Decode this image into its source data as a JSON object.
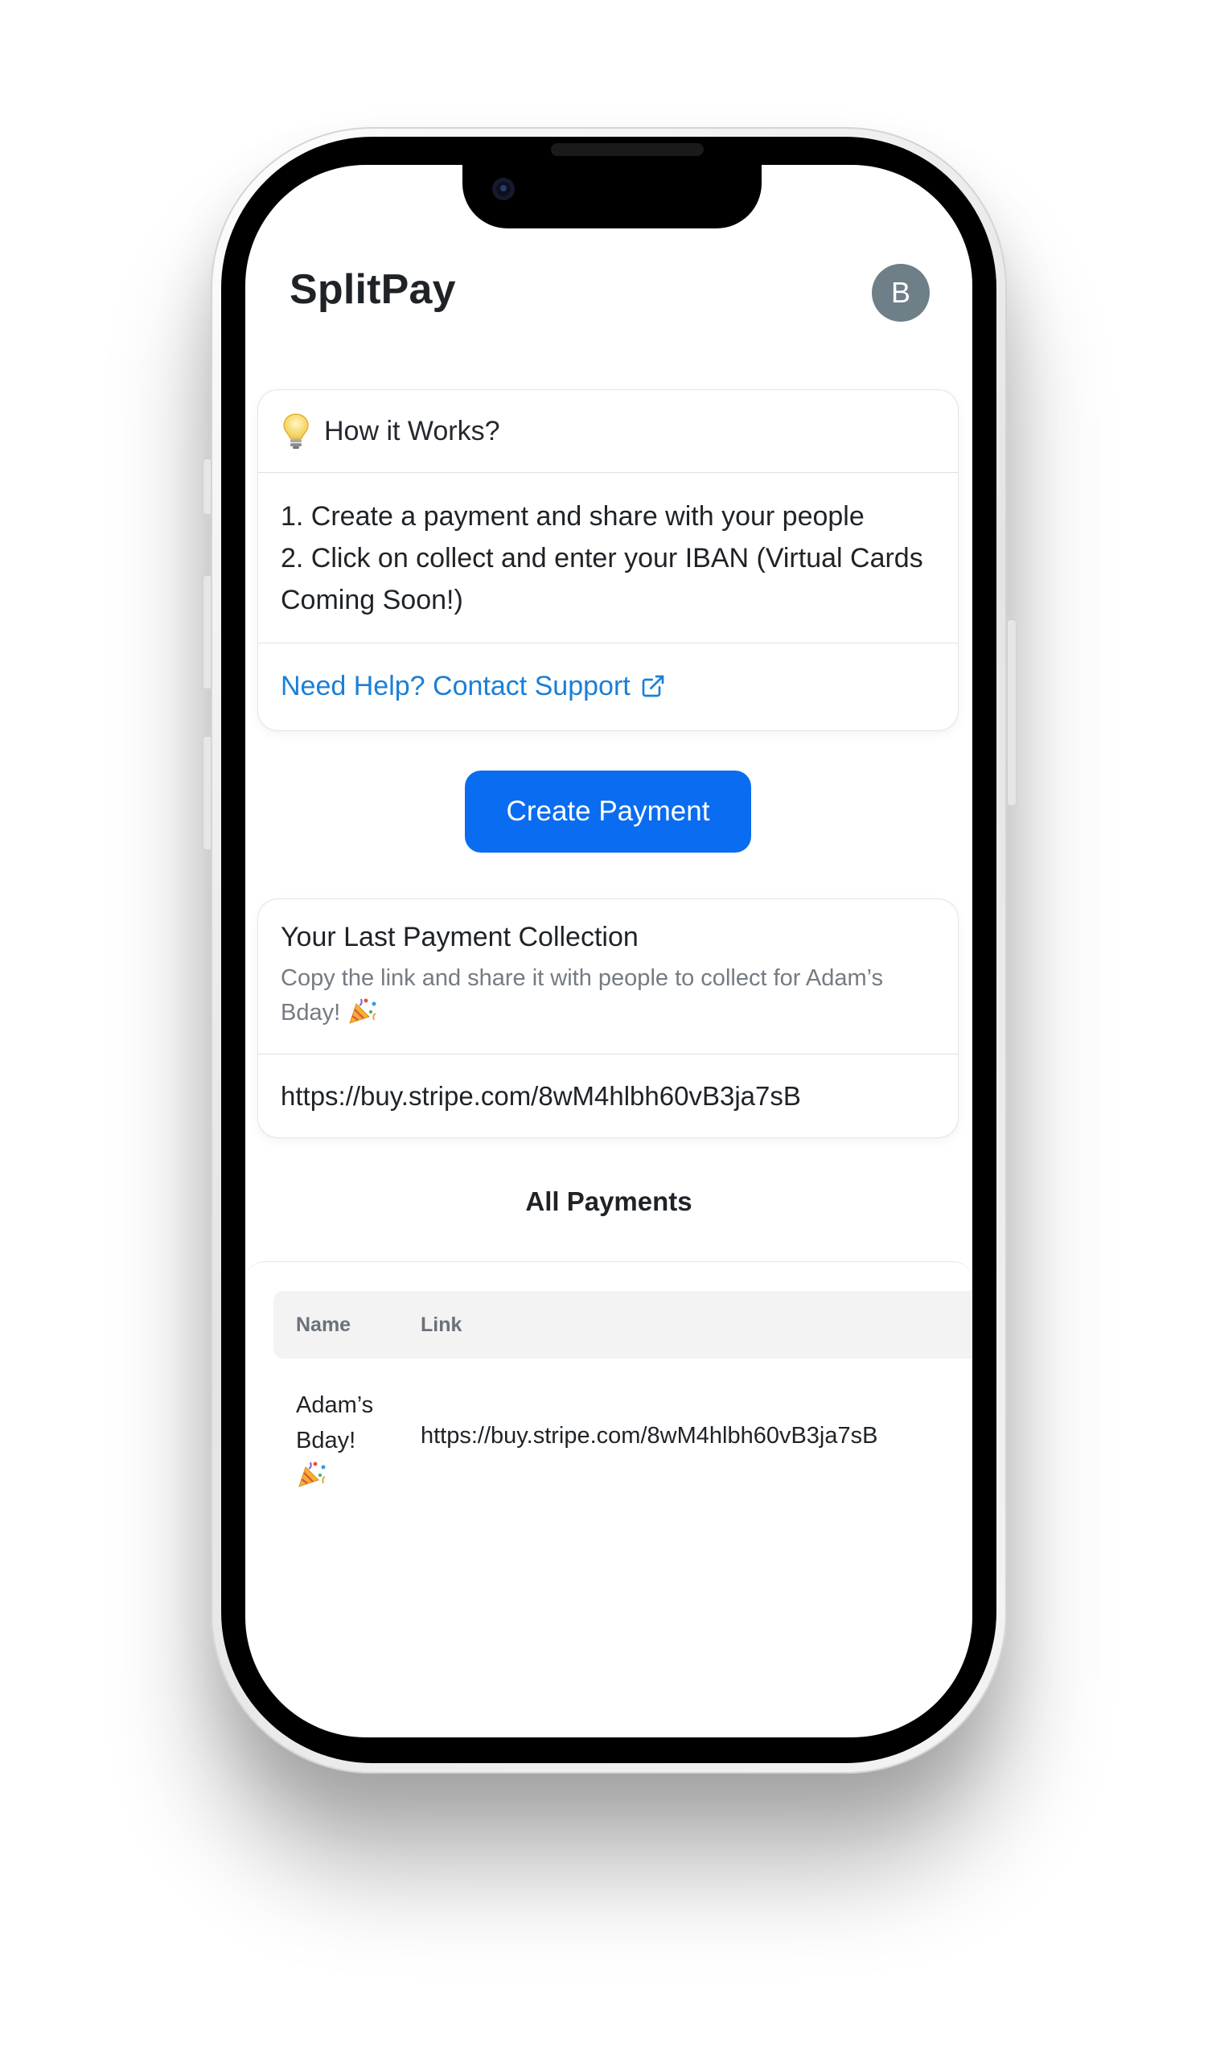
{
  "app": {
    "title": "SplitPay",
    "avatar_initial": "B"
  },
  "how_it_works": {
    "heading": "How it Works?",
    "icon": "lightbulb-icon",
    "steps": [
      "1. Create a payment and share with your people",
      "2. Click on collect and enter your IBAN (Virtual Cards Coming Soon!)"
    ],
    "help_link": "Need Help? Contact Support"
  },
  "create_button": {
    "label": "Create Payment"
  },
  "last_collection": {
    "title": "Your Last Payment Collection",
    "subtitle": "Copy the link and share it with people to collect for Adam’s Bday!",
    "link": "https://buy.stripe.com/8wM4hlbh60vB3ja7sB"
  },
  "all_payments": {
    "title": "All Payments",
    "columns": [
      "Name",
      "Link"
    ],
    "rows": [
      {
        "name": "Adam’s Bday!",
        "link": "https://buy.stripe.com/8wM4hlbh60vB3ja7sB"
      }
    ]
  },
  "colors": {
    "primary": "#0a6cf0",
    "link": "#1a7fd7",
    "avatar_bg": "#6f7f88",
    "text": "#1f2328",
    "muted": "#757b83"
  }
}
